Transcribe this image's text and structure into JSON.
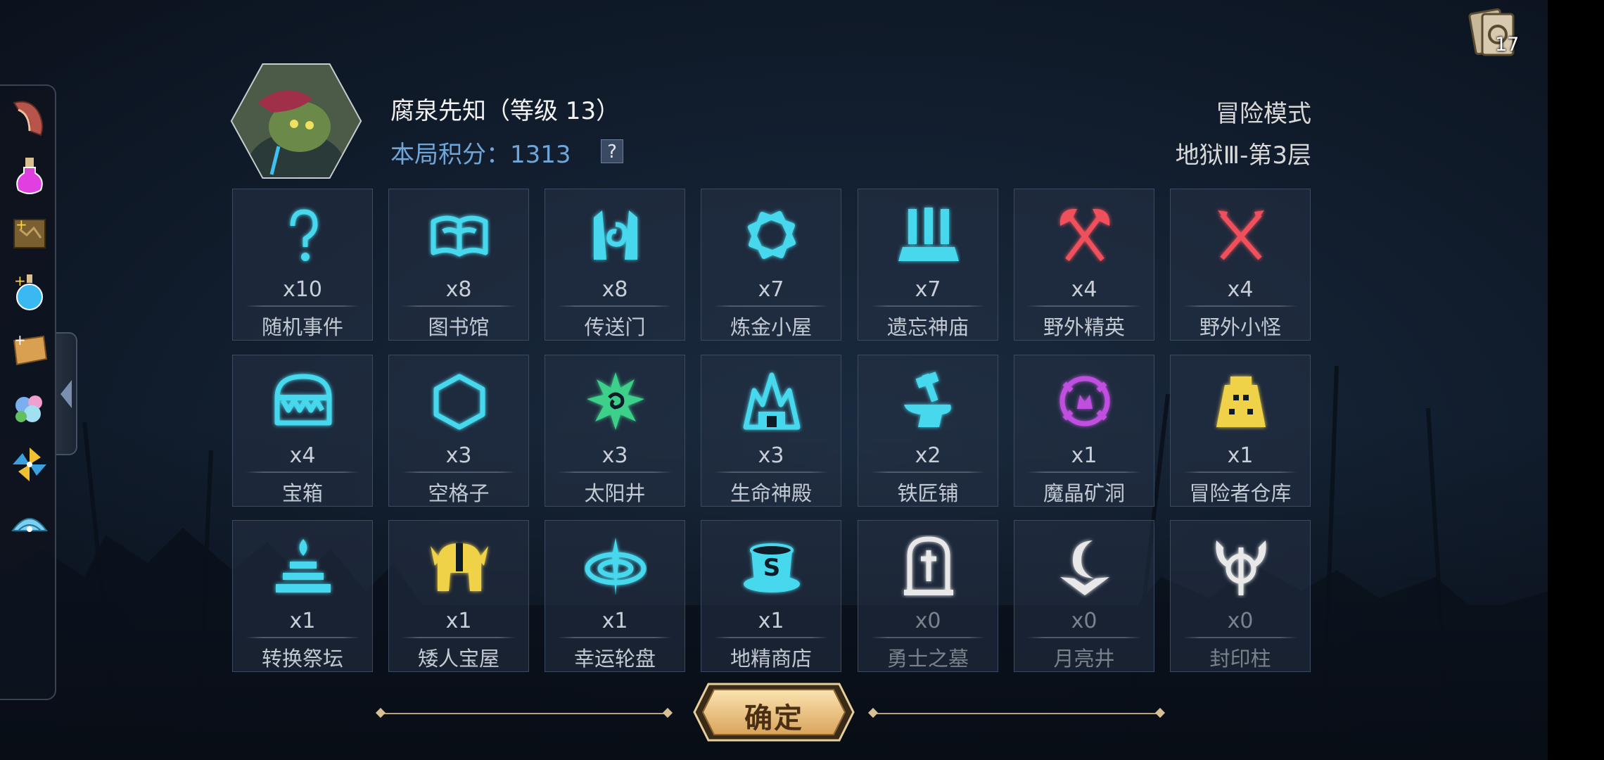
{
  "hero": {
    "name": "腐泉先知（等级 13）",
    "score_text": "本局积分：1313",
    "help_label": "?"
  },
  "mode": {
    "name": "冒险模式",
    "level": "地狱Ⅲ-第3层"
  },
  "deck": {
    "count": "17",
    "icon": "card-deck-icon"
  },
  "sidebar": {
    "items": [
      {
        "icon": "spellbook-scroll-icon"
      },
      {
        "icon": "magic-potion-icon"
      },
      {
        "icon": "add-map-icon"
      },
      {
        "icon": "add-flask-icon"
      },
      {
        "icon": "add-scroll-icon"
      },
      {
        "icon": "flower-bouquet-icon"
      },
      {
        "icon": "pinwheel-icon"
      },
      {
        "icon": "seashell-icon"
      }
    ],
    "collapse_icon": "chevron-left-icon"
  },
  "tiles": [
    {
      "count": "x10",
      "label": "随机事件",
      "icon": "question-mark-icon",
      "color": "#46d8ee",
      "dim": false
    },
    {
      "count": "x8",
      "label": "图书馆",
      "icon": "open-book-icon",
      "color": "#46d8ee",
      "dim": false
    },
    {
      "count": "x8",
      "label": "传送门",
      "icon": "portal-gate-icon",
      "color": "#46d8ee",
      "dim": false
    },
    {
      "count": "x7",
      "label": "炼金小屋",
      "icon": "alchemy-frame-icon",
      "color": "#46d8ee",
      "dim": false
    },
    {
      "count": "x7",
      "label": "遗忘神庙",
      "icon": "temple-icon",
      "color": "#46d8ee",
      "dim": false
    },
    {
      "count": "x4",
      "label": "野外精英",
      "icon": "crossed-axes-icon",
      "color": "#f0505c",
      "dim": false
    },
    {
      "count": "x4",
      "label": "野外小怪",
      "icon": "crossed-swords-icon",
      "color": "#f0505c",
      "dim": false
    },
    {
      "count": "x4",
      "label": "宝箱",
      "icon": "mimic-chest-icon",
      "color": "#46d8ee",
      "dim": false
    },
    {
      "count": "x3",
      "label": "空格子",
      "icon": "hexagon-icon",
      "color": "#46d8ee",
      "dim": false
    },
    {
      "count": "x3",
      "label": "太阳井",
      "icon": "sun-well-icon",
      "color": "#3cd08a",
      "dim": false
    },
    {
      "count": "x3",
      "label": "生命神殿",
      "icon": "life-shrine-icon",
      "color": "#46d8ee",
      "dim": false
    },
    {
      "count": "x2",
      "label": "铁匠铺",
      "icon": "anvil-hammer-icon",
      "color": "#46d8ee",
      "dim": false
    },
    {
      "count": "x1",
      "label": "魔晶矿洞",
      "icon": "crystal-mine-icon",
      "color": "#c050e0",
      "dim": false
    },
    {
      "count": "x1",
      "label": "冒险者仓库",
      "icon": "warehouse-tower-icon",
      "color": "#f0d24a",
      "dim": false
    },
    {
      "count": "x1",
      "label": "转换祭坛",
      "icon": "altar-icon",
      "color": "#46d8ee",
      "dim": false
    },
    {
      "count": "x1",
      "label": "矮人宝屋",
      "icon": "dwarf-helmet-icon",
      "color": "#f0d24a",
      "dim": false
    },
    {
      "count": "x1",
      "label": "幸运轮盘",
      "icon": "lucky-wheel-icon",
      "color": "#46d8ee",
      "dim": false
    },
    {
      "count": "x1",
      "label": "地精商店",
      "icon": "goblin-shop-icon",
      "color": "#46d8ee",
      "dim": false
    },
    {
      "count": "x0",
      "label": "勇士之墓",
      "icon": "tombstone-icon",
      "color": "#e8e8e8",
      "dim": true
    },
    {
      "count": "x0",
      "label": "月亮井",
      "icon": "moon-well-icon",
      "color": "#e8e8e8",
      "dim": true
    },
    {
      "count": "x0",
      "label": "封印柱",
      "icon": "seal-pillar-icon",
      "color": "#e8e8e8",
      "dim": true
    }
  ],
  "confirm": {
    "label": "确定"
  }
}
